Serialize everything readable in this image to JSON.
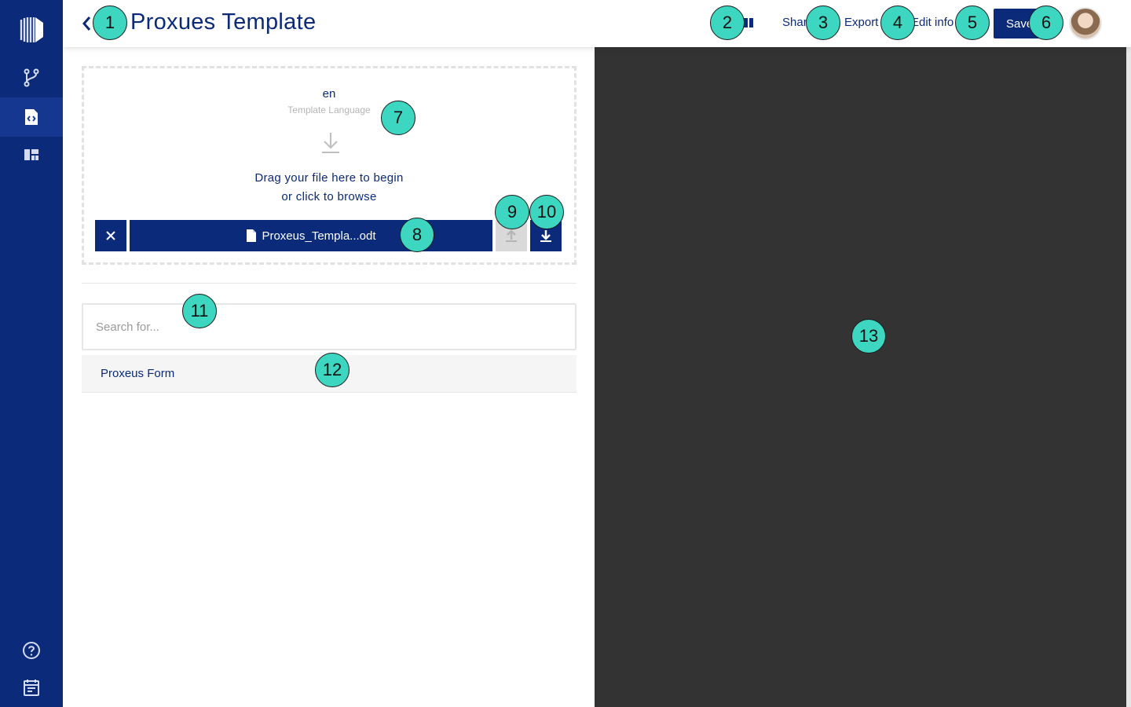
{
  "sidebar": {
    "items": [
      {
        "icon": "logo-icon"
      },
      {
        "icon": "workflow-icon"
      },
      {
        "icon": "template-icon",
        "active": true
      },
      {
        "icon": "dashboard-icon"
      },
      {
        "icon": "help-icon"
      },
      {
        "icon": "calendar-icon"
      }
    ]
  },
  "header": {
    "title": "Proxues Template",
    "share_label": "Share",
    "export_label": "Export",
    "edit_label": "Edit info",
    "save_label": "Save"
  },
  "upload": {
    "language_code": "en",
    "language_label": "Template Language",
    "drop_line1": "Drag your file here to begin",
    "drop_line2": "or click to browse",
    "file_name": "Proxeus_Templa...odt"
  },
  "search": {
    "placeholder": "Search for..."
  },
  "forms": [
    {
      "label": "Proxeus Form"
    }
  ],
  "markers": [
    "1",
    "2",
    "3",
    "4",
    "5",
    "6",
    "7",
    "8",
    "9",
    "10",
    "11",
    "12",
    "13"
  ],
  "colors": {
    "primary": "#0b2a7a",
    "marker": "#3dd6c0",
    "preview_bg": "#333333"
  }
}
